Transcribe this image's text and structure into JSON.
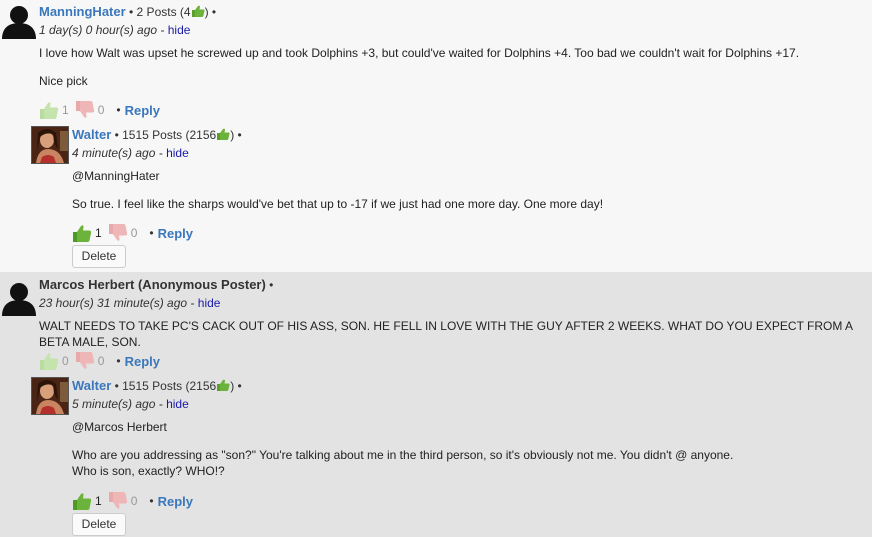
{
  "comments": [
    {
      "author": "ManningHater",
      "meta": "• 2 Posts (4",
      "meta_end": ") •",
      "time": "1 day(s) 0 hour(s) ago",
      "hide": "hide",
      "text_lines": [
        "I love how Walt was upset he screwed up and took Dolphins +3, but could've waited for Dolphins +4.  Too bad we couldn't wait for Dolphins +17.",
        "Nice pick"
      ],
      "up": "1",
      "down": "0",
      "reply": "Reply",
      "reply_item": {
        "author": "Walter",
        "meta": "• 1515 Posts (2156",
        "meta_end": ") •",
        "time": "4 minute(s) ago",
        "hide": "hide",
        "mention": "@ManningHater",
        "text": "So true. I feel like the sharps would've bet that up to -17 if we just had one more day. One more day!",
        "up": "1",
        "down": "0",
        "reply": "Reply",
        "delete": "Delete"
      }
    },
    {
      "author": "Marcos Herbert (Anonymous Poster)",
      "meta": "•",
      "time": "23 hour(s) 31 minute(s) ago",
      "hide": "hide",
      "text_lines": [
        "WALT NEEDS  TO TAKE PC'S CACK OUT OF HIS ASS, SON. HE FELL IN LOVE WITH THE GUY AFTER 2 WEEKS. WHAT DO YOU EXPECT FROM A",
        "BETA MALE, SON."
      ],
      "up": "0",
      "down": "0",
      "reply": "Reply",
      "reply_item": {
        "author": "Walter",
        "meta": "• 1515 Posts (2156",
        "meta_end": ") •",
        "time": "5 minute(s) ago",
        "hide": "hide",
        "mention": "@Marcos Herbert",
        "text_lines": [
          "Who are you addressing as \"son?\" You're talking about me in the third person, so it's obviously not me. You didn't @ anyone.",
          "Who is son, exactly? WHO!?"
        ],
        "up": "1",
        "down": "0",
        "reply": "Reply",
        "delete": "Delete"
      }
    }
  ],
  "colors": {
    "link": "#3a77bb",
    "hide_link": "#1a1aa8",
    "thumb_up": "#6bb33a",
    "thumb_down": "#e07a7a"
  },
  "icons": {
    "avatar": "silhouette-avatar-icon",
    "thumbs_up": "thumbs-up-icon",
    "thumbs_down": "thumbs-down-icon"
  }
}
